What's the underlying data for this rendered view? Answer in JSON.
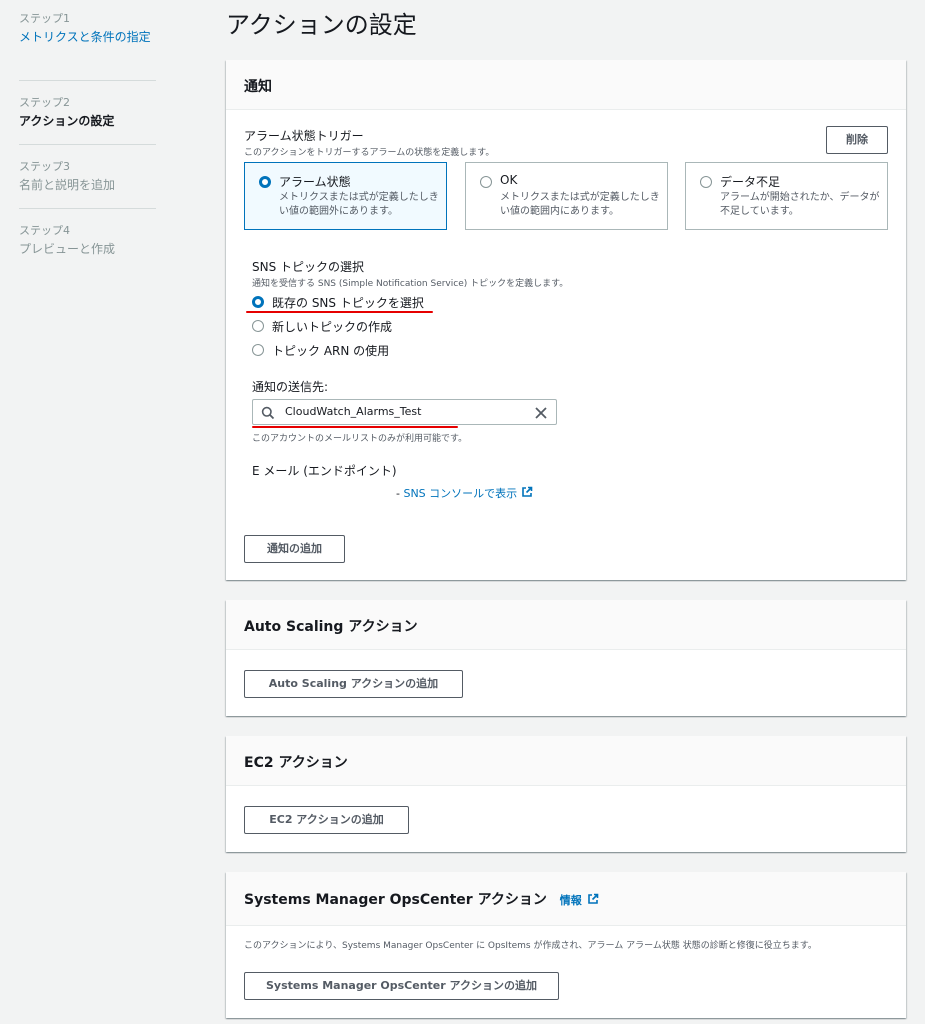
{
  "sidebar": {
    "steps": [
      {
        "num": "ステップ1",
        "title": "メトリクスと条件の指定"
      },
      {
        "num": "ステップ2",
        "title": "アクションの設定"
      },
      {
        "num": "ステップ3",
        "title": "名前と説明を追加"
      },
      {
        "num": "ステップ4",
        "title": "プレビューと作成"
      }
    ]
  },
  "page": {
    "title": "アクションの設定"
  },
  "notification": {
    "header": "通知",
    "trigger_label": "アラーム状態トリガー",
    "trigger_desc": "このアクションをトリガーするアラームの状態を定義します。",
    "remove_label": "削除",
    "tiles": [
      {
        "title": "アラーム状態",
        "desc": "メトリクスまたは式が定義したしきい値の範囲外にあります。"
      },
      {
        "title": "OK",
        "desc": "メトリクスまたは式が定義したしきい値の範囲内にあります。"
      },
      {
        "title": "データ不足",
        "desc": "アラームが開始されたか、データが不足しています。"
      }
    ],
    "sns_label": "SNS トピックの選択",
    "sns_desc": "通知を受信する SNS (Simple Notification Service) トピックを定義します。",
    "sns_options": [
      "既存の SNS トピックを選択",
      "新しいトピックの作成",
      "トピック ARN の使用"
    ],
    "send_to_label": "通知の送信先:",
    "send_to_value": "CloudWatch_Alarms_Test",
    "send_to_hint": "このアカウントのメールリストのみが利用可能です。",
    "email_label": "E メール (エンドポイント)",
    "sns_console_prefix": "- ",
    "sns_console_link": "SNS コンソールで表示",
    "add_notification_label": "通知の追加"
  },
  "autoscaling": {
    "header": "Auto Scaling アクション",
    "add_label": "Auto Scaling アクションの追加"
  },
  "ec2": {
    "header": "EC2 アクション",
    "add_label": "EC2 アクションの追加"
  },
  "opscenter": {
    "header": "Systems Manager OpsCenter アクション",
    "info_label": "情報",
    "desc": "このアクションにより、Systems Manager OpsCenter に OpsItems が作成され、アラーム アラーム状態 状態の診断と修復に役立ちます。",
    "add_label": "Systems Manager OpsCenter アクションの追加"
  },
  "colors": {
    "accent": "#0073bb",
    "highlight_underline": "#e60000"
  }
}
